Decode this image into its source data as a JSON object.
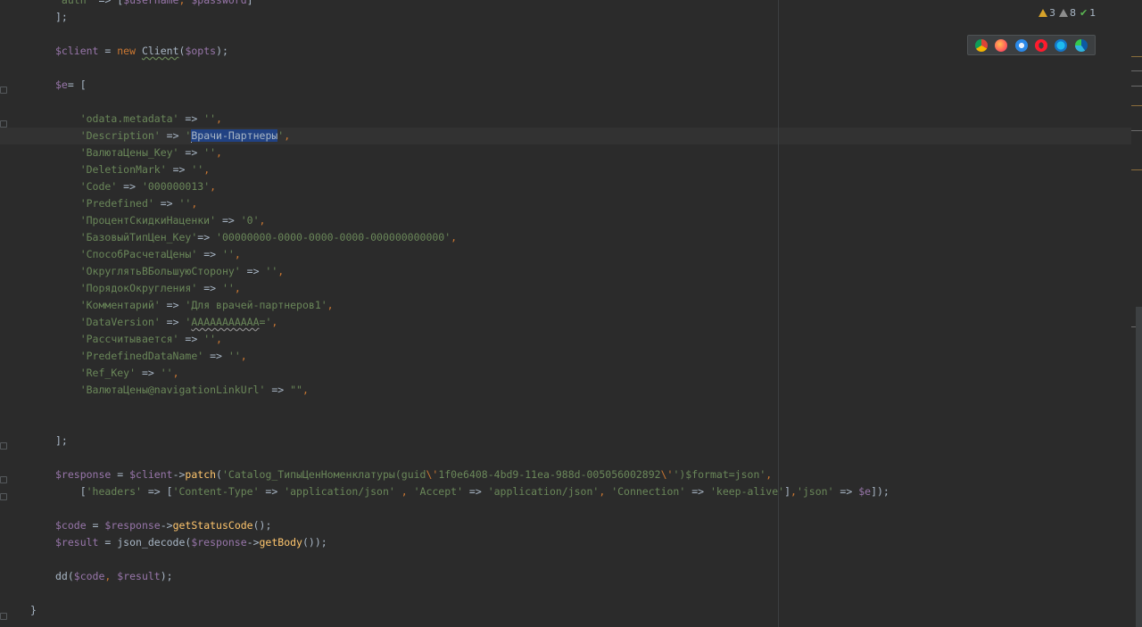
{
  "code_lines": [
    {
      "n": 0,
      "segs": [
        [
          "s",
          "'auth'"
        ],
        [
          "t",
          " => ["
        ],
        [
          "v",
          "$username"
        ],
        [
          "p",
          ", "
        ],
        [
          "v",
          "$password"
        ],
        [
          "t",
          "]"
        ]
      ]
    },
    {
      "n": 1,
      "segs": [
        [
          "t",
          "];"
        ]
      ]
    },
    {
      "n": 3,
      "segs": [
        [
          "v",
          "$client"
        ],
        [
          "t",
          " = "
        ],
        [
          "kw",
          "new "
        ],
        [
          "cls",
          "Client"
        ],
        [
          "t",
          "("
        ],
        [
          "v",
          "$opts"
        ],
        [
          "t",
          ");"
        ]
      ]
    },
    {
      "n": 5,
      "segs": [
        [
          "v",
          "$e"
        ],
        [
          "t",
          "= ["
        ]
      ]
    },
    {
      "n": 7,
      "segs": [
        [
          "t",
          "    "
        ],
        [
          "s",
          "'odata.metadata'"
        ],
        [
          "t",
          " => "
        ],
        [
          "s",
          "''"
        ],
        [
          "p",
          ","
        ]
      ]
    },
    {
      "n": 8,
      "segs": [
        [
          "t",
          "    "
        ],
        [
          "s",
          "'Description'"
        ],
        [
          "t",
          " => "
        ],
        [
          "s",
          "'"
        ],
        [
          "caret",
          ""
        ],
        [
          "sel",
          "Врачи-Партнеры"
        ],
        [
          "s",
          "'"
        ],
        [
          "p",
          ","
        ]
      ]
    },
    {
      "n": 9,
      "segs": [
        [
          "t",
          "    "
        ],
        [
          "s",
          "'ВалютаЦены_Key'"
        ],
        [
          "t",
          " => "
        ],
        [
          "s",
          "''"
        ],
        [
          "p",
          ","
        ]
      ]
    },
    {
      "n": 10,
      "segs": [
        [
          "t",
          "    "
        ],
        [
          "s",
          "'DeletionMark'"
        ],
        [
          "t",
          " => "
        ],
        [
          "s",
          "''"
        ],
        [
          "p",
          ","
        ]
      ]
    },
    {
      "n": 11,
      "segs": [
        [
          "t",
          "    "
        ],
        [
          "s",
          "'Code'"
        ],
        [
          "t",
          " => "
        ],
        [
          "s",
          "'000000013'"
        ],
        [
          "p",
          ","
        ]
      ]
    },
    {
      "n": 12,
      "segs": [
        [
          "t",
          "    "
        ],
        [
          "s",
          "'Predefined'"
        ],
        [
          "t",
          " => "
        ],
        [
          "s",
          "''"
        ],
        [
          "p",
          ","
        ]
      ]
    },
    {
      "n": 13,
      "segs": [
        [
          "t",
          "    "
        ],
        [
          "s",
          "'ПроцентСкидкиНаценки'"
        ],
        [
          "t",
          " => "
        ],
        [
          "s",
          "'0'"
        ],
        [
          "p",
          ","
        ]
      ]
    },
    {
      "n": 14,
      "segs": [
        [
          "t",
          "    "
        ],
        [
          "s",
          "'БазовыйТипЦен_Key'"
        ],
        [
          "t",
          "=> "
        ],
        [
          "s",
          "'00000000-0000-0000-0000-000000000000'"
        ],
        [
          "p",
          ","
        ]
      ]
    },
    {
      "n": 15,
      "segs": [
        [
          "t",
          "    "
        ],
        [
          "s",
          "'СпособРасчетаЦены'"
        ],
        [
          "t",
          " => "
        ],
        [
          "s",
          "''"
        ],
        [
          "p",
          ","
        ]
      ]
    },
    {
      "n": 16,
      "segs": [
        [
          "t",
          "    "
        ],
        [
          "s",
          "'ОкруглятьВБольшуюСторону'"
        ],
        [
          "t",
          " => "
        ],
        [
          "s",
          "''"
        ],
        [
          "p",
          ","
        ]
      ]
    },
    {
      "n": 17,
      "segs": [
        [
          "t",
          "    "
        ],
        [
          "s",
          "'ПорядокОкругления'"
        ],
        [
          "t",
          " => "
        ],
        [
          "s",
          "''"
        ],
        [
          "p",
          ","
        ]
      ]
    },
    {
      "n": 18,
      "segs": [
        [
          "t",
          "    "
        ],
        [
          "s",
          "'Комментарий'"
        ],
        [
          "t",
          " => "
        ],
        [
          "s",
          "'Для врачей-партнеров1'"
        ],
        [
          "p",
          ","
        ]
      ]
    },
    {
      "n": 19,
      "segs": [
        [
          "t",
          "    "
        ],
        [
          "s",
          "'DataVersion'"
        ],
        [
          "t",
          " => "
        ],
        [
          "s",
          "'"
        ],
        [
          "wavy",
          "AAAAAAAAAAA"
        ],
        [
          "s",
          "='"
        ],
        [
          "p",
          ","
        ]
      ]
    },
    {
      "n": 20,
      "segs": [
        [
          "t",
          "    "
        ],
        [
          "s",
          "'Рассчитывается'"
        ],
        [
          "t",
          " => "
        ],
        [
          "s",
          "''"
        ],
        [
          "p",
          ","
        ]
      ]
    },
    {
      "n": 21,
      "segs": [
        [
          "t",
          "    "
        ],
        [
          "s",
          "'PredefinedDataName'"
        ],
        [
          "t",
          " => "
        ],
        [
          "s",
          "''"
        ],
        [
          "p",
          ","
        ]
      ]
    },
    {
      "n": 22,
      "segs": [
        [
          "t",
          "    "
        ],
        [
          "s",
          "'Ref_Key'"
        ],
        [
          "t",
          " => "
        ],
        [
          "s",
          "''"
        ],
        [
          "p",
          ","
        ]
      ]
    },
    {
      "n": 23,
      "segs": [
        [
          "t",
          "    "
        ],
        [
          "s",
          "'ВалютаЦены@navigationLinkUrl'"
        ],
        [
          "t",
          " => "
        ],
        [
          "s",
          "\"\""
        ],
        [
          "p",
          ","
        ]
      ]
    },
    {
      "n": 26,
      "segs": [
        [
          "t",
          "];"
        ]
      ]
    },
    {
      "n": 28,
      "segs": [
        [
          "v",
          "$response"
        ],
        [
          "t",
          " = "
        ],
        [
          "v",
          "$client"
        ],
        [
          "t",
          "->"
        ],
        [
          "f",
          "patch"
        ],
        [
          "t",
          "("
        ],
        [
          "s",
          "'Catalog_ТипыЦенНоменклатуры(guid"
        ],
        [
          "kw",
          "\\'"
        ],
        [
          "s",
          "1f0e6408-4bd9-11ea-988d-005056002892"
        ],
        [
          "kw",
          "\\'"
        ],
        [
          "s",
          "')$format=json'"
        ],
        [
          "p",
          ","
        ]
      ]
    },
    {
      "n": 29,
      "segs": [
        [
          "t",
          "    ["
        ],
        [
          "s",
          "'headers'"
        ],
        [
          "t",
          " => ["
        ],
        [
          "s",
          "'Content-Type'"
        ],
        [
          "t",
          " => "
        ],
        [
          "s",
          "'application/json'"
        ],
        [
          "p",
          " , "
        ],
        [
          "s",
          "'Accept'"
        ],
        [
          "t",
          " => "
        ],
        [
          "s",
          "'application/json'"
        ],
        [
          "p",
          ", "
        ],
        [
          "s",
          "'Connection'"
        ],
        [
          "t",
          " => "
        ],
        [
          "s",
          "'keep-alive'"
        ],
        [
          "t",
          "]"
        ],
        [
          "p",
          ","
        ],
        [
          "s",
          "'json'"
        ],
        [
          "t",
          " => "
        ],
        [
          "v",
          "$e"
        ],
        [
          "t",
          "]);"
        ]
      ]
    },
    {
      "n": 31,
      "segs": [
        [
          "v",
          "$code"
        ],
        [
          "t",
          " = "
        ],
        [
          "v",
          "$response"
        ],
        [
          "t",
          "->"
        ],
        [
          "f",
          "getStatusCode"
        ],
        [
          "t",
          "();"
        ]
      ]
    },
    {
      "n": 32,
      "segs": [
        [
          "v",
          "$result"
        ],
        [
          "t",
          " = json_decode("
        ],
        [
          "v",
          "$response"
        ],
        [
          "t",
          "->"
        ],
        [
          "f",
          "getBody"
        ],
        [
          "t",
          "());"
        ]
      ]
    },
    {
      "n": 34,
      "segs": [
        [
          "t",
          "dd("
        ],
        [
          "v",
          "$code"
        ],
        [
          "p",
          ", "
        ],
        [
          "v",
          "$result"
        ],
        [
          "t",
          ");"
        ]
      ]
    },
    {
      "n": 36,
      "indent": "outer",
      "segs": [
        [
          "t",
          "}"
        ]
      ]
    }
  ],
  "inspections": {
    "warnings": "3",
    "weak_warnings": "8",
    "typos": "1"
  },
  "browsers": [
    "chrome-icon",
    "firefox-icon",
    "safari-icon",
    "opera-icon",
    "ie-icon",
    "edge-icon"
  ],
  "colors": {
    "background": "#2b2b2b",
    "variable": "#9876aa",
    "string": "#6a8759",
    "keyword": "#cc7832",
    "function": "#ffc66d",
    "selection": "#214283"
  }
}
